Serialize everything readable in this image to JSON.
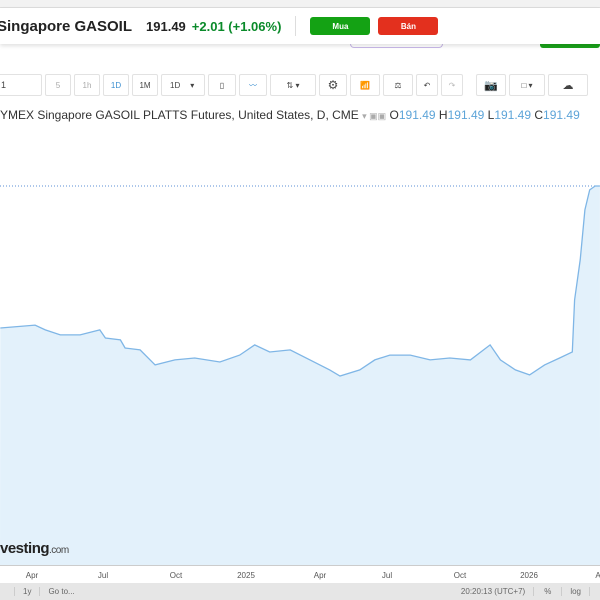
{
  "header": {
    "title": "Singapore GASOIL",
    "price": "191.49",
    "change": "+2.01 (+1.06%)",
    "buy_label": "Mua",
    "sell_label": "Bán"
  },
  "toolbar": {
    "symbol_value": "1",
    "intervals": [
      "5",
      "1h",
      "1D",
      "1M",
      "1D"
    ],
    "active_interval": "1D"
  },
  "legend": {
    "series": "YMEX Singapore GASOIL PLATTS Futures, United States, D, CME",
    "o_label": "O",
    "o": "191.49",
    "h_label": "H",
    "h": "191.49",
    "l_label": "L",
    "l": "191.49",
    "c_label": "C",
    "c": "191.49"
  },
  "logo": {
    "text": "vesting",
    "suffix": ".com"
  },
  "bottom": {
    "range": "1y",
    "goto": "Go to...",
    "time": "20:20:13 (UTC+7)",
    "percent": "%",
    "log": "log"
  },
  "colors": {
    "line": "#7fb6e6",
    "fill": "#e3f1fb",
    "buy": "#14a214",
    "sell": "#e3301e",
    "up": "#0a8a2a"
  },
  "chart_data": {
    "type": "area",
    "x_tick_labels": [
      "Apr",
      "Jul",
      "Oct",
      "2025",
      "Apr",
      "Jul",
      "Oct",
      "2026",
      "A"
    ],
    "last_price": 191.49,
    "points": [
      [
        "2024-02-25",
        97.8
      ],
      [
        "2024-04-09",
        99.7
      ],
      [
        "2024-04-22",
        96.5
      ],
      [
        "2024-05-11",
        93.2
      ],
      [
        "2024-06-05",
        93.2
      ],
      [
        "2024-06-30",
        96.5
      ],
      [
        "2024-07-07",
        91.2
      ],
      [
        "2024-07-26",
        89.9
      ],
      [
        "2024-08-01",
        84.6
      ],
      [
        "2024-08-20",
        83.3
      ],
      [
        "2024-09-08",
        73.4
      ],
      [
        "2024-10-03",
        76.7
      ],
      [
        "2024-10-28",
        78.0
      ],
      [
        "2024-11-29",
        75.3
      ],
      [
        "2024-12-24",
        79.9
      ],
      [
        "2025-01-12",
        86.6
      ],
      [
        "2025-01-31",
        81.9
      ],
      [
        "2025-02-26",
        83.3
      ],
      [
        "2025-03-23",
        76.7
      ],
      [
        "2025-04-17",
        70.1
      ],
      [
        "2025-04-30",
        66.1
      ],
      [
        "2025-05-25",
        70.1
      ],
      [
        "2025-06-13",
        76.7
      ],
      [
        "2025-07-02",
        79.9
      ],
      [
        "2025-07-28",
        79.9
      ],
      [
        "2025-08-22",
        76.7
      ],
      [
        "2025-09-16",
        78.0
      ],
      [
        "2025-10-12",
        76.7
      ],
      [
        "2025-11-06",
        86.6
      ],
      [
        "2025-11-19",
        76.7
      ],
      [
        "2025-12-08",
        70.1
      ],
      [
        "2025-12-26",
        66.8
      ],
      [
        "2026-01-14",
        73.4
      ],
      [
        "2026-02-02",
        78.0
      ],
      [
        "2026-02-18",
        81.9
      ],
      [
        "2026-02-21",
        116.3
      ],
      [
        "2026-02-28",
        142.7
      ],
      [
        "2026-03-06",
        175.7
      ],
      [
        "2026-03-12",
        188.9
      ],
      [
        "2026-03-19",
        191.5
      ],
      [
        "2026-03-25",
        191.5
      ]
    ]
  }
}
